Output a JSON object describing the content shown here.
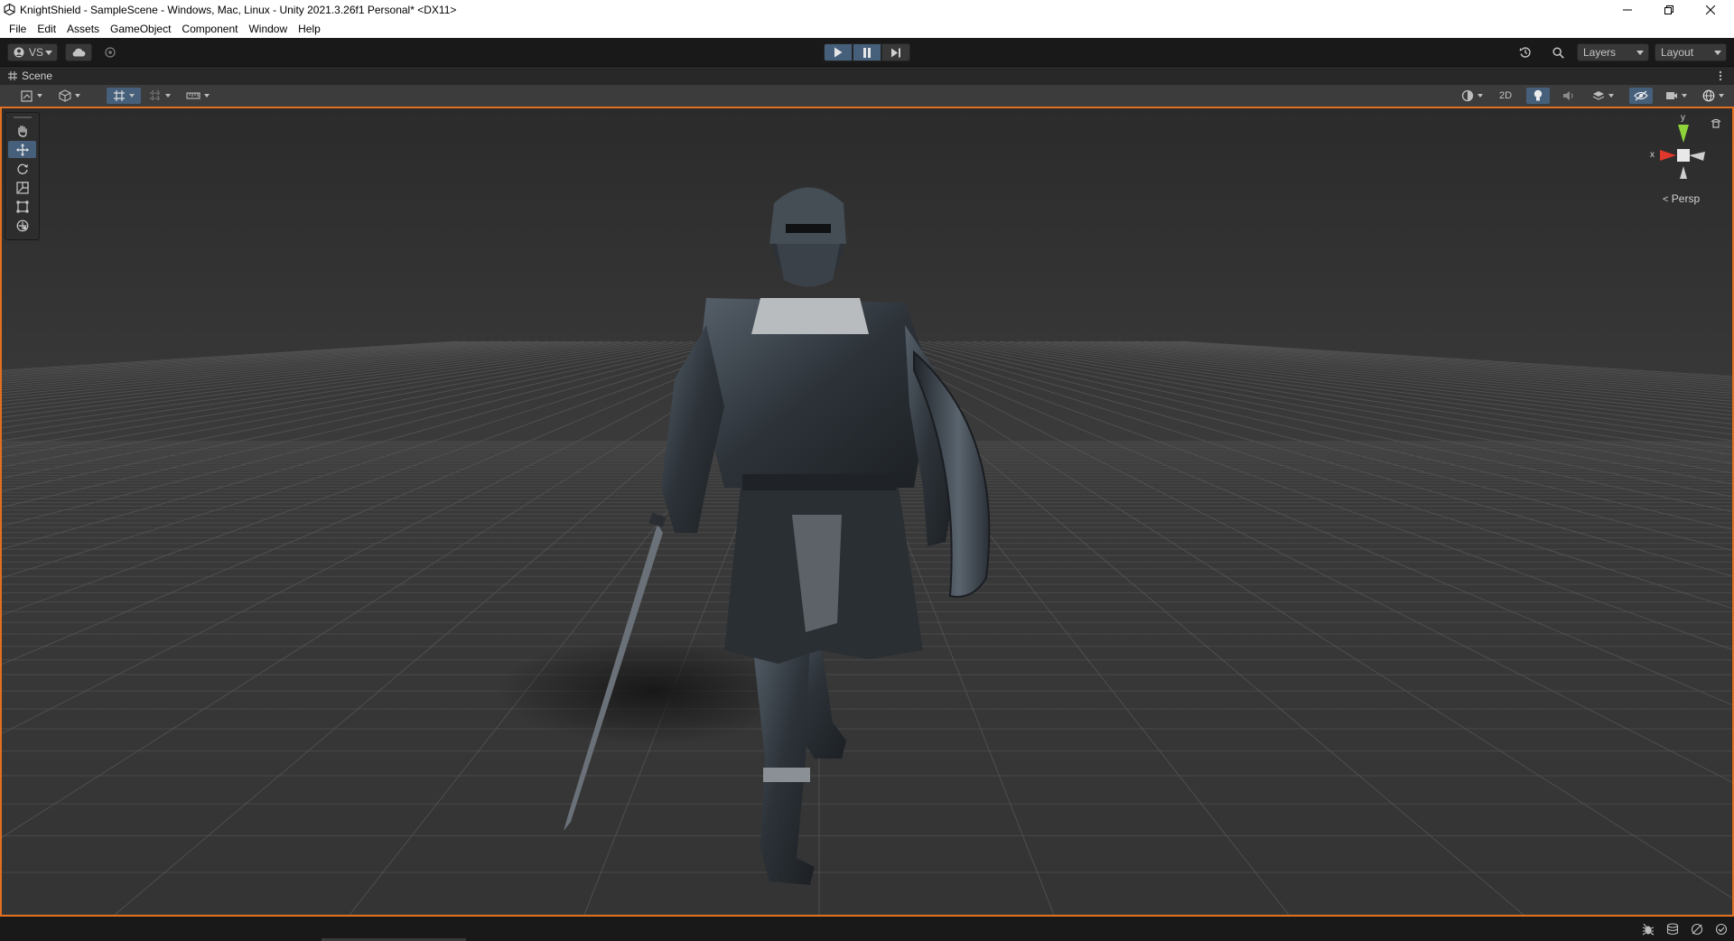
{
  "window": {
    "title": "KnightShield - SampleScene - Windows, Mac, Linux - Unity 2021.3.26f1 Personal* <DX11>",
    "controls": [
      "minimize",
      "restore",
      "close"
    ]
  },
  "menu": [
    "File",
    "Edit",
    "Assets",
    "GameObject",
    "Component",
    "Window",
    "Help"
  ],
  "toolbar": {
    "account_label": "VS",
    "playback": {
      "play_active": true,
      "pause_active": true,
      "step_active": false
    },
    "layers_label": "Layers",
    "layout_label": "Layout"
  },
  "scene_tab": {
    "label": "Scene"
  },
  "scene_toolbar": {
    "mode_2d_label": "2D"
  },
  "tools": [
    "hand-tool",
    "move-tool",
    "rotate-tool",
    "scale-tool",
    "rect-tool",
    "transform-tool"
  ],
  "active_tool": "move-tool",
  "gizmo": {
    "x_label": "x",
    "y_label": "y",
    "projection_label": "Persp"
  },
  "colors": {
    "accent_blue": "#46607c",
    "viewport_border": "#e07020",
    "axis_x": "#e0382c",
    "axis_y": "#8ed33a",
    "axis_z": "#3a7ee0"
  }
}
